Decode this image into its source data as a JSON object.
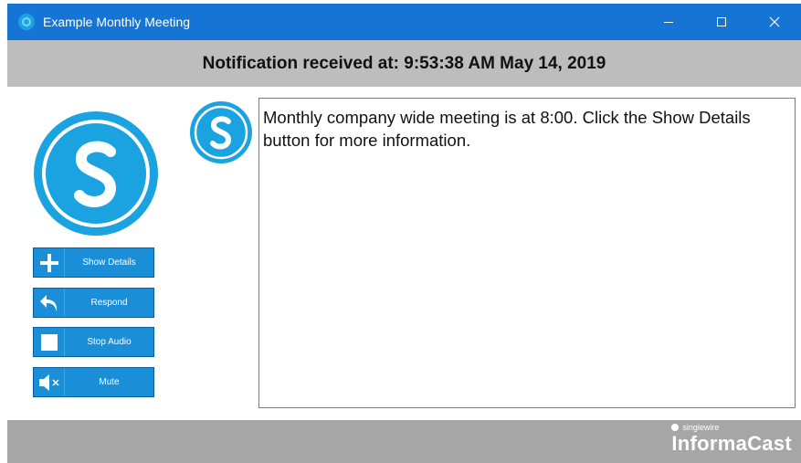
{
  "window": {
    "title": "Example Monthly Meeting",
    "controls": {
      "minimize": "—",
      "maximize": "□",
      "close": "✕"
    }
  },
  "banner": {
    "text": "Notification received at: 9:53:38 AM May 14, 2019"
  },
  "buttons": [
    {
      "label": "Show Details",
      "icon": "plus-icon"
    },
    {
      "label": "Respond",
      "icon": "reply-arrow-icon"
    },
    {
      "label": "Stop Audio",
      "icon": "stop-square-icon"
    },
    {
      "label": "Mute",
      "icon": "speaker-mute-icon"
    }
  ],
  "message": {
    "text": "Monthly company wide meeting is at 8:00. Click the Show Details button for more information."
  },
  "brand": {
    "company": "singlewire",
    "product": "InformaCast"
  },
  "colors": {
    "titlebar": "#1574d4",
    "accent": "#1a8fd8",
    "logo": "#1aa3e0",
    "banner": "#bdbdbd",
    "footer": "#a6a6a6"
  }
}
